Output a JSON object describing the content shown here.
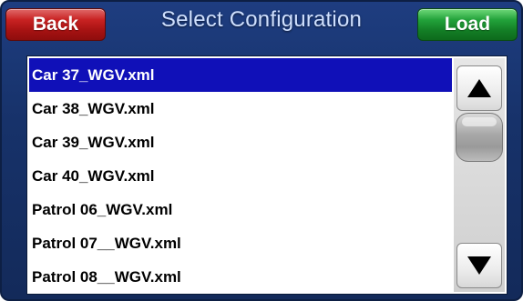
{
  "header": {
    "back_label": "Back",
    "title": "Select Configuration",
    "load_label": "Load"
  },
  "list": {
    "selected_index": 0,
    "items": [
      {
        "label": "Car 37_WGV.xml"
      },
      {
        "label": "Car 38_WGV.xml"
      },
      {
        "label": "Car 39_WGV.xml"
      },
      {
        "label": "Car 40_WGV.xml"
      },
      {
        "label": "Patrol 06_WGV.xml"
      },
      {
        "label": "Patrol 07__WGV.xml"
      },
      {
        "label": "Patrol 08__WGV.xml"
      }
    ]
  },
  "scrollbar": {
    "up_icon": "triangle-up-icon",
    "down_icon": "triangle-down-icon"
  },
  "colors": {
    "background": "#17326a",
    "back_button": "#c82222",
    "load_button": "#22a23a",
    "selection": "#1010b8",
    "title_text": "#cfe0ff"
  }
}
